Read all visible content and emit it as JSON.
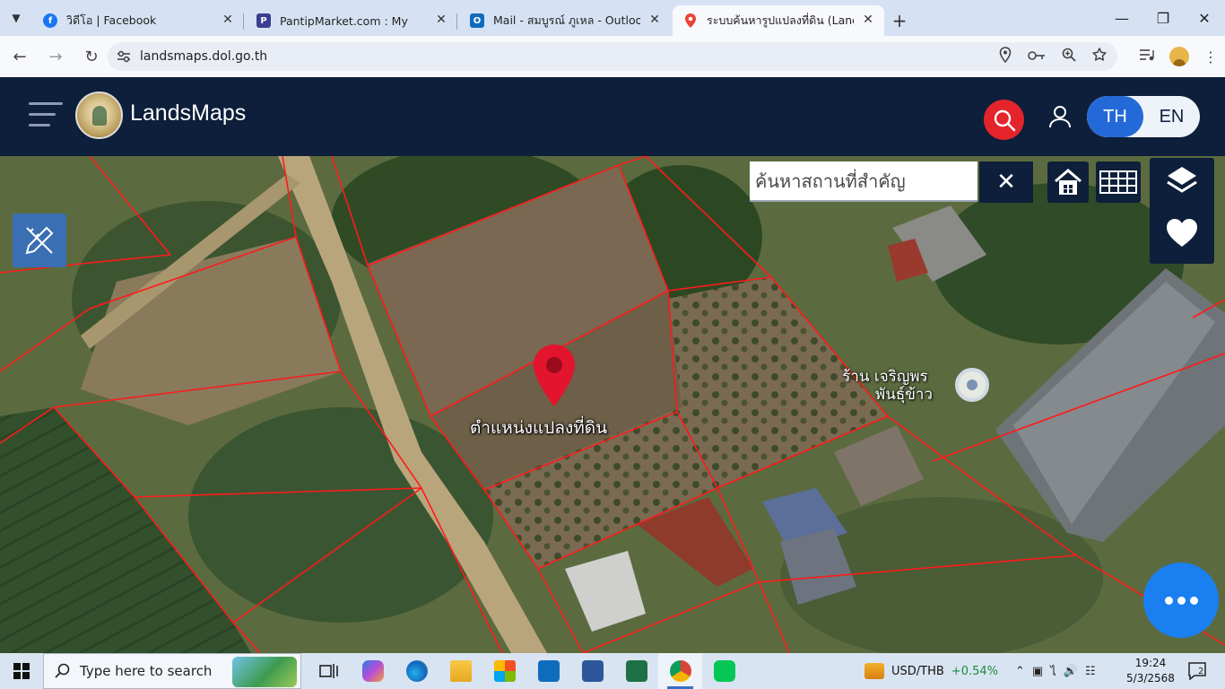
{
  "browser": {
    "tabs": [
      {
        "title": "วิดีโอ | Facebook",
        "favicon": "facebook-icon",
        "color": "#1877f2"
      },
      {
        "title": "PantipMarket.com : My",
        "favicon": "pantip-icon",
        "color": "#3b3f8f"
      },
      {
        "title": "Mail - สมบูรณ์ ภูเหล - Outlook",
        "favicon": "outlook-icon",
        "color": "#0f6cbd"
      },
      {
        "title": "ระบบค้นหารูปแปลงที่ดิน (LandsMaps",
        "favicon": "map-pin-icon",
        "color": "#ea4335"
      }
    ],
    "url": "landsmaps.dol.go.th"
  },
  "header": {
    "brand": "LandsMaps",
    "lang_th": "TH",
    "lang_en": "EN"
  },
  "map": {
    "search_placeholder": "ค้นหาสถานที่สำคัญ",
    "marker_label": "ตำแหน่งแปลงที่ดิน",
    "poi_line1": "ร้าน เจริญพร",
    "poi_line2": "พันธุ์ข้าว",
    "boundary_color": "#ff1a1a",
    "marker_color": "#e3142d"
  },
  "taskbar": {
    "search_placeholder": "Type here to search",
    "ticker_symbol": "USD/THB",
    "ticker_change": "+0.54%",
    "time": "19:24",
    "date": "5/3/2568",
    "notifications": "2"
  }
}
